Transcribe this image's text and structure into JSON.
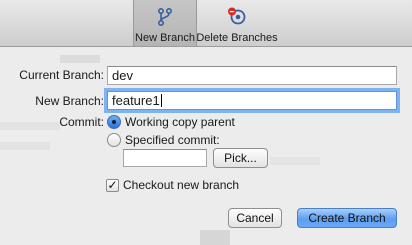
{
  "toolbar": {
    "new_branch": {
      "label": "New Branch",
      "icon": "branch-icon",
      "selected": true
    },
    "delete_branches": {
      "label": "Delete Branches",
      "icon": "delete-branch-icon"
    }
  },
  "form": {
    "current_branch": {
      "label": "Current Branch:",
      "value": "dev"
    },
    "new_branch": {
      "label": "New Branch:",
      "value": "feature1"
    },
    "commit": {
      "label": "Commit:",
      "options": [
        {
          "label": "Working copy parent",
          "selected": true
        },
        {
          "label": "Specified commit:",
          "selected": false
        }
      ],
      "specified_value": "",
      "pick_label": "Pick..."
    },
    "checkout": {
      "label": "Checkout new branch",
      "checked": true
    }
  },
  "buttons": {
    "cancel": "Cancel",
    "create": "Create Branch"
  },
  "colors": {
    "accent": "#5d9ef0",
    "focus_ring": "#7db3f0",
    "delete_icon_red": "#d82a2a",
    "branch_icon_blue": "#3a5f9c"
  }
}
